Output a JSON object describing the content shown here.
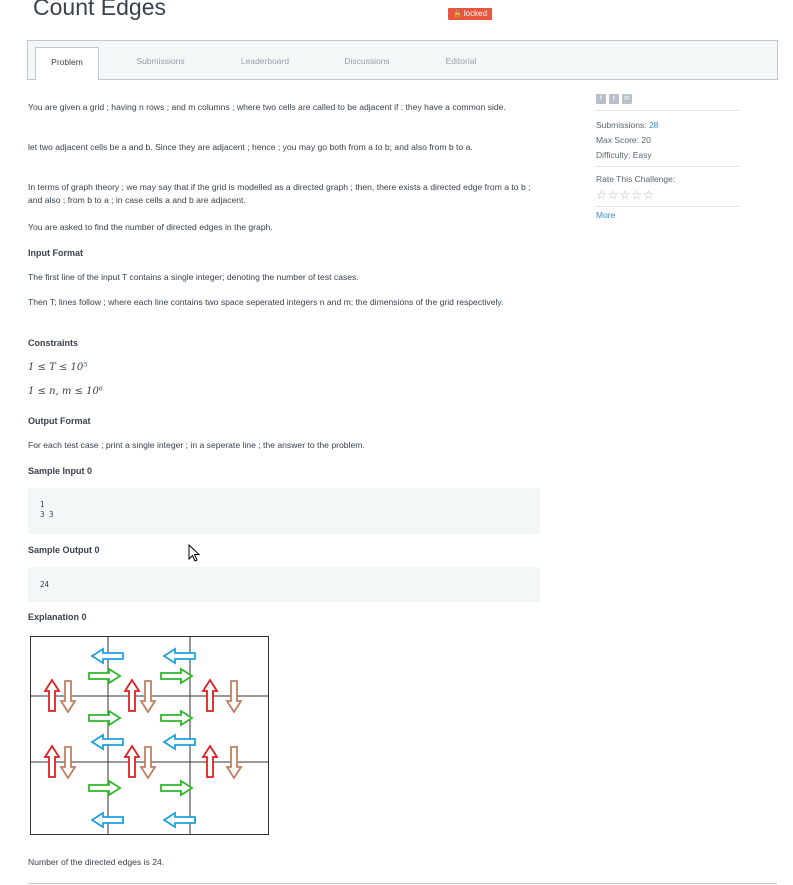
{
  "header": {
    "title": "Count Edges",
    "badge": "locked"
  },
  "tabs": [
    {
      "label": "Problem",
      "active": true
    },
    {
      "label": "Submissions"
    },
    {
      "label": "Leaderboard"
    },
    {
      "label": "Discussions"
    },
    {
      "label": "Editorial"
    }
  ],
  "problem": {
    "p1": "You are given a grid ; having n rows ; and m columns ; where two cells are called to be adjacent if : they have a common side.",
    "p2": "let two adjacent cells be a and b. Since they are adjacent ; hence ; you may go both from a to b; and also from b to a.",
    "p3": "In terms of graph theory ; we may say that if the grid is modelled as a directed graph ; then, there exists a directed edge from a to b ; and also ; from b to a ; in case cells a and b are adjacent.",
    "p4": "You are asked to find the number of directed edges in the graph.",
    "input_heading": "Input Format",
    "p5": "The first line of the input T contains a single integer; denoting the number of test cases.",
    "p6": "Then T; lines follow ; where each line contains two space seperated integers n and m; the dimensions of the grid respectively.",
    "constraints_heading": "Constraints",
    "c1": "1 ≤ T ≤ 10⁵",
    "c2": "1 ≤ n, m ≤ 10⁶",
    "output_heading": "Output Format",
    "p7": "For each test case ; print a single integer ; in a seperate line ; the answer to the problem.",
    "sample_input_heading": "Sample Input 0",
    "sample_input_line1": "1",
    "sample_input_line2": "3 3",
    "sample_output_heading": "Sample Output 0",
    "sample_output": "24",
    "explanation_heading": "Explanation 0",
    "explanation_text": "Number of the directed edges is 24."
  },
  "sidebar": {
    "social_icons": [
      "facebook-icon",
      "twitter-icon",
      "linkedin-icon"
    ],
    "submissions_label": "Submissions:",
    "submissions_value": "28",
    "max_score_label": "Max Score:",
    "max_score_value": "20",
    "difficulty_label": "Difficulty:",
    "difficulty_value": "Easy",
    "rate_label": "Rate This Challenge:",
    "stars": "☆☆☆☆☆",
    "more_link": "More"
  },
  "colors": {
    "accent_blue": "#3b8bd8",
    "locked_red": "#e7563d",
    "arrow_red": "#e02020",
    "arrow_brown": "#c08060",
    "arrow_green": "#2eb82e",
    "arrow_blue": "#1ea0e0"
  }
}
